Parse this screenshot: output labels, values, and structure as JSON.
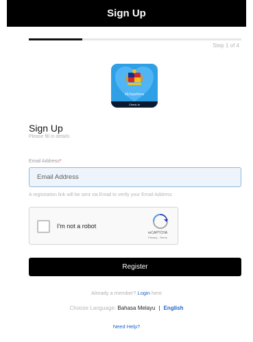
{
  "header": {
    "title": "Sign Up"
  },
  "progress": {
    "fraction": 0.25,
    "step_text": "Step 1 of 4"
  },
  "logo": {
    "caption": "MySejahtera",
    "band_text": "Check-In",
    "icon": "shield-heart-logo"
  },
  "form": {
    "title": "Sign Up",
    "subtitle": "Please fill in details",
    "email_label": "Email Address",
    "required_mark": "*",
    "email_placeholder": "Email Address",
    "email_value": "",
    "email_note": "A registration link will be sent via Email to verify your Email Address"
  },
  "recaptcha": {
    "label": "I'm not a robot",
    "brand": "reCAPTCHA",
    "terms": "Privacy - Terms",
    "icon": "recaptcha-icon"
  },
  "register": {
    "label": "Register"
  },
  "login": {
    "prefix": "Already a member?",
    "link": "Login",
    "suffix": "here"
  },
  "language": {
    "prefix": "Choose Language:",
    "bm": "Bahasa Melayu",
    "separator": "|",
    "en": "English"
  },
  "help": {
    "label": "Need Help?"
  },
  "colors": {
    "accent": "#1e63c8",
    "header_bg": "#000000",
    "logo_bg": "#2f9fe6",
    "required": "#e5322d"
  }
}
